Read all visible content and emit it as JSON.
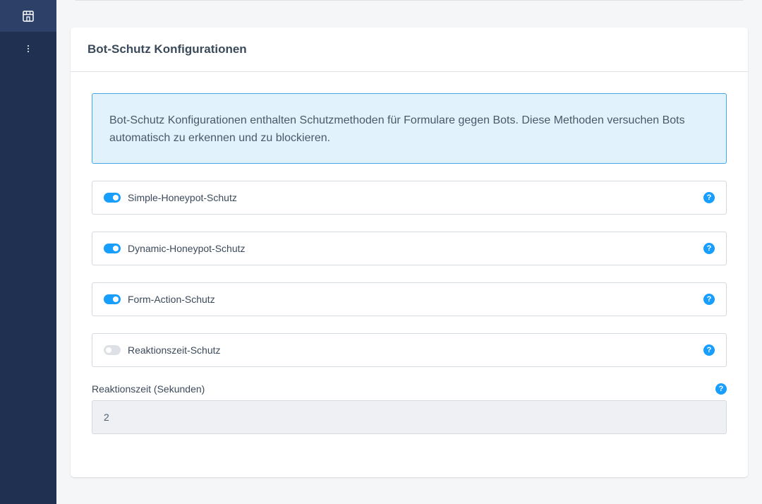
{
  "sidebar": {
    "top_icon": "storefront-icon",
    "more_icon": "more-vertical-icon"
  },
  "card": {
    "title": "Bot-Schutz Konfigurationen",
    "info": "Bot-Schutz Konfigurationen enthalten Schutzmethoden für Formulare gegen Bots. Diese Methoden versuchen Bots automatisch zu erkennen und zu blockieren."
  },
  "options": [
    {
      "label": "Simple-Honeypot-Schutz",
      "enabled": true
    },
    {
      "label": "Dynamic-Honeypot-Schutz",
      "enabled": true
    },
    {
      "label": "Form-Action-Schutz",
      "enabled": true
    },
    {
      "label": "Reaktionszeit-Schutz",
      "enabled": false
    }
  ],
  "reaction_field": {
    "label": "Reaktionszeit (Sekunden)",
    "value": "2"
  },
  "help_glyph": "?",
  "colors": {
    "sidebar": "#1f3050",
    "accent": "#189eff",
    "info_bg": "#e2f2fc",
    "info_border": "#45a6e6"
  }
}
